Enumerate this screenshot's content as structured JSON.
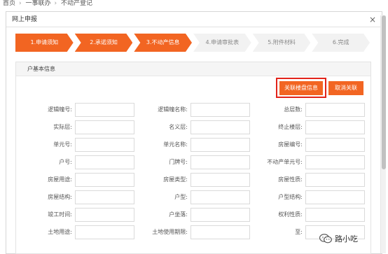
{
  "breadcrumb": [
    "首页",
    "一事联办",
    "不动产登记"
  ],
  "window": {
    "title": "网上申报",
    "close_glyph": "×"
  },
  "steps": [
    {
      "label": "1.申请须知",
      "active": true
    },
    {
      "label": "2.承诺须知",
      "active": true
    },
    {
      "label": "3.不动产信息",
      "active": true
    },
    {
      "label": "4.申请审批表",
      "active": false
    },
    {
      "label": "5.附件材料",
      "active": false
    },
    {
      "label": "6.完成",
      "active": false
    }
  ],
  "panel": {
    "title": "户基本信息",
    "link_button": "关联楼盘信息",
    "cancel_button": "取消关联"
  },
  "form_rows": [
    [
      "逻辑幢号:",
      "逻辑幢名称:",
      "总层数:"
    ],
    [
      "实际层:",
      "名义层:",
      "终止楼层:"
    ],
    [
      "单元号:",
      "单元名称:",
      "房屋编号:"
    ],
    [
      "户号:",
      "门牌号:",
      "不动产单元号:"
    ],
    [
      "房屋用途:",
      "房屋类型:",
      "房屋性质:"
    ],
    [
      "房屋结构:",
      "户型:",
      "户型结构:"
    ],
    [
      "竣工时间:",
      "户坐落:",
      "权利性质:"
    ],
    [
      "土地用途:",
      "土地使用期限:",
      "至:"
    ]
  ],
  "watermark": {
    "text": "路小吃",
    "icon": "wechat-icon"
  },
  "colors": {
    "accent": "#f26522",
    "highlight": "#e2231a"
  }
}
